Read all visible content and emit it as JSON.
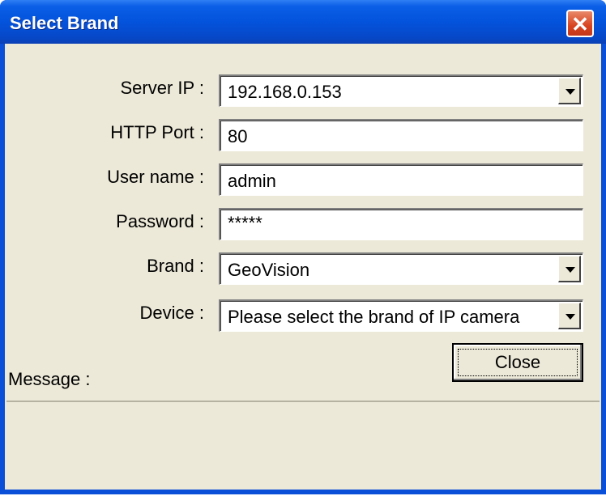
{
  "window": {
    "title": "Select Brand",
    "close_icon": "close-icon"
  },
  "form": {
    "server_ip": {
      "label": "Server IP :",
      "value": "192.168.0.153"
    },
    "http_port": {
      "label": "HTTP Port :",
      "value": "80"
    },
    "user_name": {
      "label": "User name :",
      "value": "admin"
    },
    "password": {
      "label": "Password :",
      "value": "*****"
    },
    "brand": {
      "label": "Brand :",
      "value": "GeoVision"
    },
    "device": {
      "label": "Device :",
      "value": "Please select the brand of IP camera"
    }
  },
  "buttons": {
    "close": "Close"
  },
  "message": {
    "label": "Message :"
  }
}
